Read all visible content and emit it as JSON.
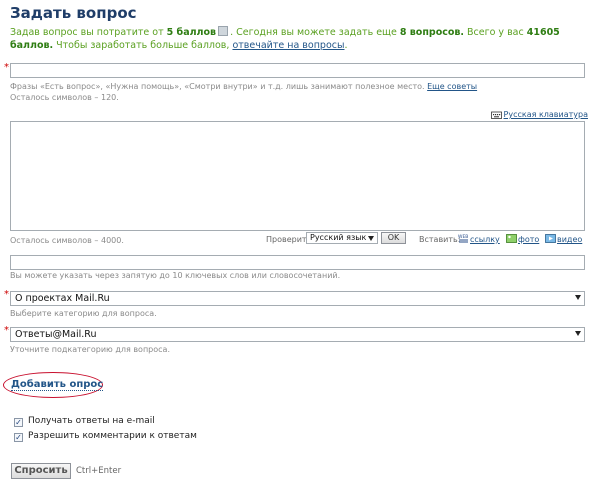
{
  "header": {
    "title": "Задать вопрос"
  },
  "info": {
    "part1": "Задав вопрос вы потратите от ",
    "cost": "5 баллов",
    "part2": ". Сегодня вы можете задать еще ",
    "remaining": "8 вопросов.",
    "part3": " Всего у вас ",
    "total": "41605 баллов.",
    "part4": " Чтобы заработать больше баллов, ",
    "earn_link": "отвечайте на вопросы",
    "part5": "."
  },
  "question": {
    "required_mark": "*",
    "value": "",
    "hint": "Фразы «Есть вопрос», «Нужна помощь», «Смотри внутри» и т.д. лишь занимают полезное место.",
    "hint_link": "Еще советы",
    "chars_left": "Осталось символов – 120."
  },
  "keyboard": {
    "icon_text": "RUS",
    "label": "Русская клавиатура"
  },
  "details": {
    "value": "",
    "chars_left": "Осталось символов – 4000.",
    "check_label": "Проверить",
    "language_selected": "Русский язык",
    "ok_label": "OK",
    "insert_label": "Вставить:",
    "link_label": "ссылку",
    "photo_label": "фото",
    "video_label": "видео"
  },
  "keywords": {
    "value": "",
    "hint": "Вы можете указать через запятую до 10 ключевых слов или словосочетаний."
  },
  "category": {
    "required_mark": "*",
    "selected": "О проектах Mail.Ru",
    "hint": "Выберите категорию для вопроса."
  },
  "subcategory": {
    "required_mark": "*",
    "selected": "Ответы@Mail.Ru",
    "hint": "Уточните подкатегорию для вопроса."
  },
  "poll": {
    "label": "Добавить опрос"
  },
  "options": [
    {
      "label": "Получать ответы на e-mail",
      "checked": true
    },
    {
      "label": "Разрешить комментарии к ответам",
      "checked": true
    }
  ],
  "submit": {
    "label": "Спросить",
    "shortcut": "Ctrl+Enter"
  },
  "colors": {
    "title": "#1f3d68",
    "info_green": "#5aa020",
    "link": "#225588",
    "required": "#cc0000",
    "highlight_ring": "#c8102e"
  }
}
